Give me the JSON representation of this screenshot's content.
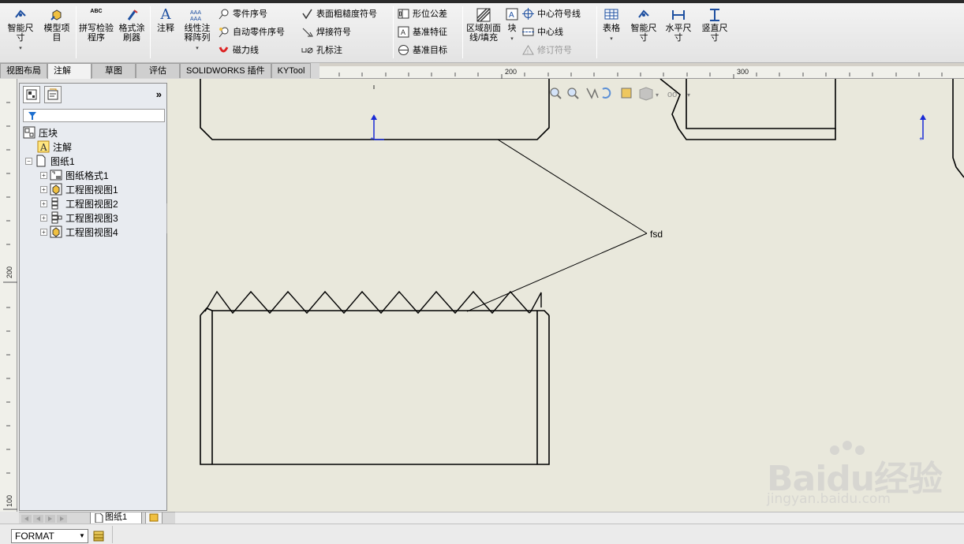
{
  "ribbon": {
    "large": {
      "smart_dim": "智能尺寸",
      "model_items": "模型项目",
      "spell_check": "拼写检验程序",
      "format_painter": "格式涂刷器",
      "note": "注释",
      "linear_pattern": "线性注释阵列",
      "area_hatch": "区域剖面线/填充",
      "block": "块",
      "table": "表格",
      "smart_dim2": "智能尺寸",
      "horizontal_dim": "水平尺寸",
      "vertical_dim": "竖直尺寸"
    },
    "small": {
      "balloon": "零件序号",
      "auto_balloon": "自动零件序号",
      "magnetic_line": "磁力线",
      "surface_finish": "表面粗糙度符号",
      "weld_symbol": "焊接符号",
      "hole_callout": "孔标注",
      "geo_tolerance": "形位公差",
      "datum_feature": "基准特征",
      "datum_target": "基准目标",
      "center_mark": "中心符号线",
      "centerline": "中心线",
      "revision_symbol": "修订符号"
    },
    "spell_icon_text": "ABC"
  },
  "tabs": [
    "视图布局",
    "注解",
    "草图",
    "评估",
    "SOLIDWORKS 插件",
    "KYTool"
  ],
  "ruler": {
    "h_labels": [
      "200",
      "300"
    ],
    "v_labels": [
      "200",
      "100"
    ]
  },
  "tree": {
    "root": "压块",
    "annotations": "注解",
    "sheet": "图纸1",
    "children": [
      "图纸格式1",
      "工程图视图1",
      "工程图视图2",
      "工程图视图3",
      "工程图视图4"
    ]
  },
  "drawing": {
    "note_text": "fsd"
  },
  "watermark": {
    "brand": "Baidu经验",
    "url": "jingyan.baidu.com"
  },
  "bottom": {
    "sheet_tab": "图纸1",
    "format_select": "FORMAT"
  },
  "colors": {
    "canvas_bg": "#e9e8dc",
    "origin_blue": "#1a2bd6",
    "panel_bg": "#e8ebf0"
  }
}
